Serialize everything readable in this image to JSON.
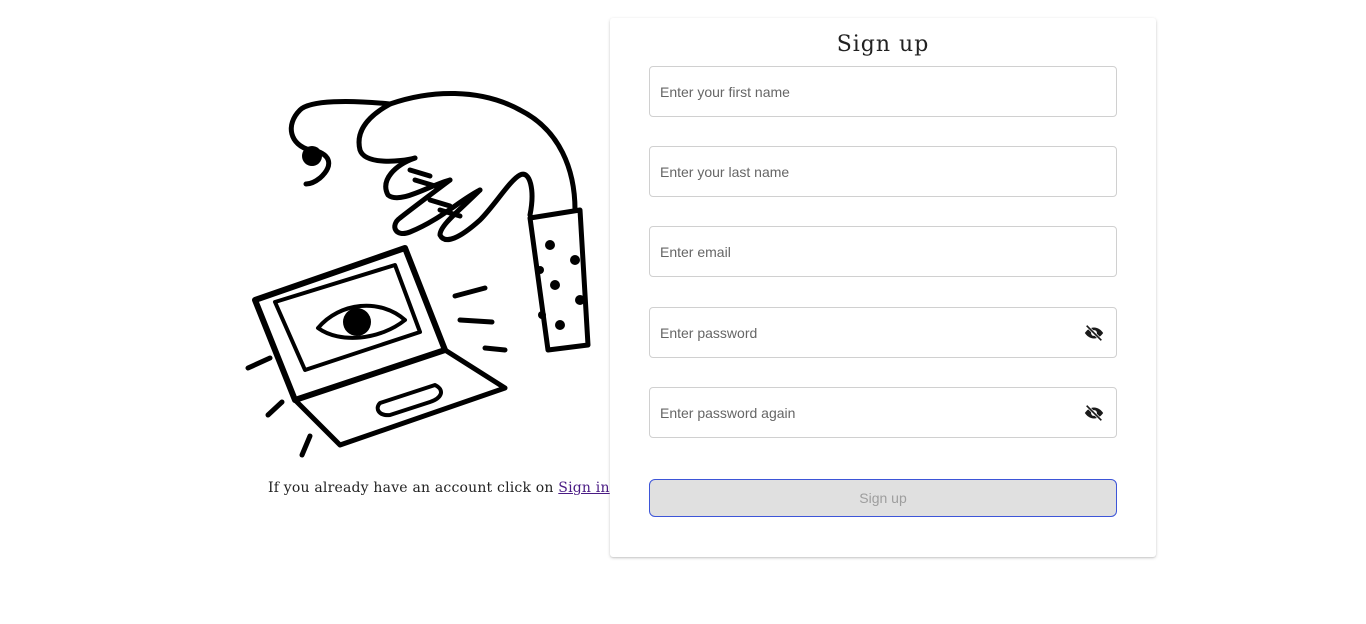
{
  "illustration": {
    "name": "hand-pressing-laptop-illustration"
  },
  "signin_prompt": {
    "text": "If you already have an account click on ",
    "link": "Sign in"
  },
  "form": {
    "title": "Sign up",
    "fields": {
      "first_name": {
        "placeholder": "Enter your first name",
        "value": ""
      },
      "last_name": {
        "placeholder": "Enter your last name",
        "value": ""
      },
      "email": {
        "placeholder": "Enter email",
        "value": ""
      },
      "password": {
        "placeholder": "Enter password",
        "value": ""
      },
      "password_again": {
        "placeholder": "Enter password again",
        "value": ""
      }
    },
    "submit_label": "Sign up"
  },
  "icons": {
    "password_toggle": "eye-off-icon",
    "password_again_toggle": "eye-off-icon"
  },
  "colors": {
    "link": "#4a1b84",
    "button_border": "#3d55d8",
    "button_bg": "#e0e0e0"
  }
}
